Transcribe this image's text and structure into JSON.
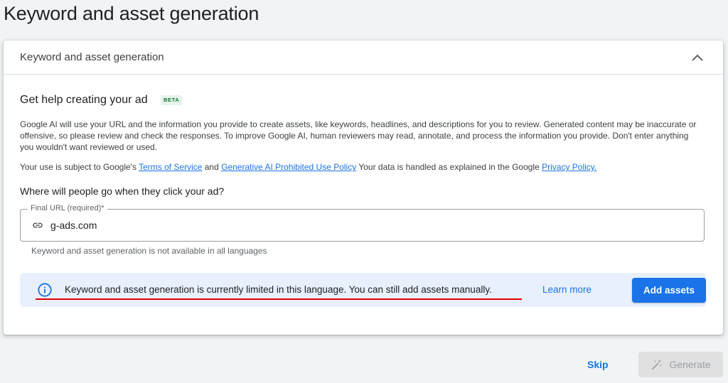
{
  "page": {
    "title": "Keyword and asset generation"
  },
  "card": {
    "header_title": "Keyword and asset generation",
    "collapse_icon": "chevron-up-icon",
    "help_title": "Get help creating your ad",
    "beta_label": "BETA",
    "disclaimer": "Google AI will use your URL and the information you provide to create assets, like keywords, headlines, and descriptions for you to review. Generated content may be inaccurate or offensive, so please review and check the responses. To improve Google AI, human reviewers may read, annotate, and process the information you provide. Don't enter anything you wouldn't want reviewed or used.",
    "terms": {
      "prefix": "Your use is subject to Google's ",
      "tos_link": "Terms of Service",
      "and": " and ",
      "policy_link": "Generative AI Prohibited Use Policy",
      "middle": " Your data is handled as explained in the Google ",
      "privacy_link": "Privacy Policy."
    },
    "question": "Where will people go when they click your ad?",
    "url_field": {
      "label": "Final URL (required)*",
      "value": "g-ads.com",
      "icon": "link-icon"
    },
    "helper_text": "Keyword and asset generation is not available in all languages",
    "notice": {
      "icon": "info-icon",
      "text": "Keyword and asset generation is currently limited in this language. You can still add assets manually.",
      "learn_more": "Learn more",
      "add_assets": "Add assets",
      "highlight_color": "#e00000",
      "background_color": "#e8f0fe"
    }
  },
  "footer": {
    "skip_label": "Skip",
    "generate_label": "Generate",
    "generate_icon": "magic-wand-icon",
    "generate_disabled": true
  },
  "colors": {
    "accent": "#1a73e8",
    "page_background": "#f1f3f4",
    "beta_badge_background": "#e6f4ea",
    "beta_badge_text": "#137333"
  }
}
